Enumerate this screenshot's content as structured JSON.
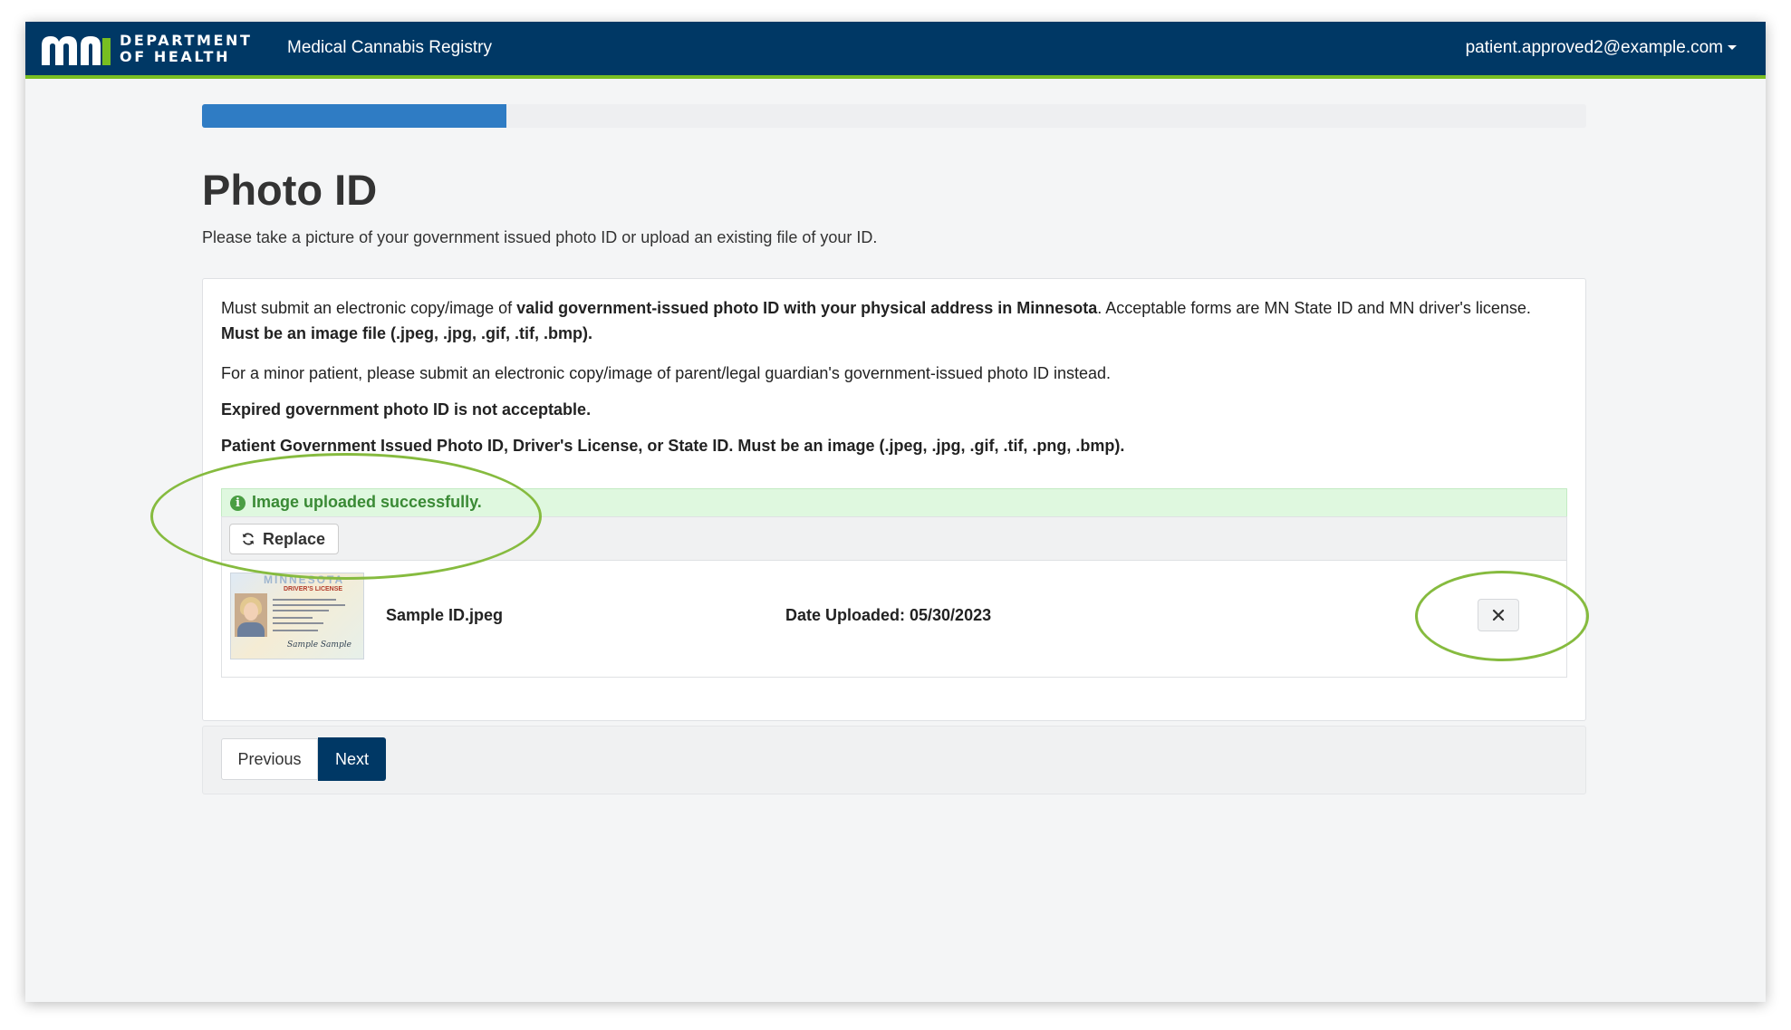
{
  "header": {
    "logo_line1": "DEPARTMENT",
    "logo_line2": "OF HEALTH",
    "app_title": "Medical Cannabis Registry",
    "user_email": "patient.approved2@example.com",
    "brand_color": "#003865",
    "accent_color": "#78be21"
  },
  "progress": {
    "fraction": 0.22,
    "color": "#2f7cc4"
  },
  "page": {
    "title": "Photo ID",
    "subtitle": "Please take a picture of your government issued photo ID or upload an existing file of your ID."
  },
  "instructions": {
    "p1_a": "Must submit an electronic copy/image of ",
    "p1_b": "valid government-issued photo ID with your physical address in Minnesota",
    "p1_c": ". Acceptable forms are MN State ID and MN driver's license. ",
    "p1_d": "Must be an image file (.jpeg, .jpg, .gif, .tif, .bmp).",
    "p2": "For a minor patient, please submit an electronic copy/image of parent/legal guardian's government-issued photo ID instead.",
    "p3": "Expired government photo ID is not acceptable.",
    "p4": "Patient Government Issued Photo ID, Driver's License, or State ID. Must be an image (.jpeg, .jpg, .gif, .tif, .png, .bmp)."
  },
  "upload": {
    "success_message": "Image uploaded successfully.",
    "replace_label": "Replace",
    "file_name": "Sample ID.jpeg",
    "date_uploaded": "Date Uploaded: 05/30/2023",
    "thumbnail": {
      "state": "MINNESOTA",
      "card_type": "DRIVER'S LICENSE",
      "signature": "Sample Sample"
    }
  },
  "nav": {
    "previous_label": "Previous",
    "next_label": "Next"
  },
  "icons": {
    "info": "info-icon",
    "replace": "refresh-icon",
    "remove": "close-icon",
    "menu": "chevron-down-icon"
  },
  "annotation_color": "#86bb3f"
}
